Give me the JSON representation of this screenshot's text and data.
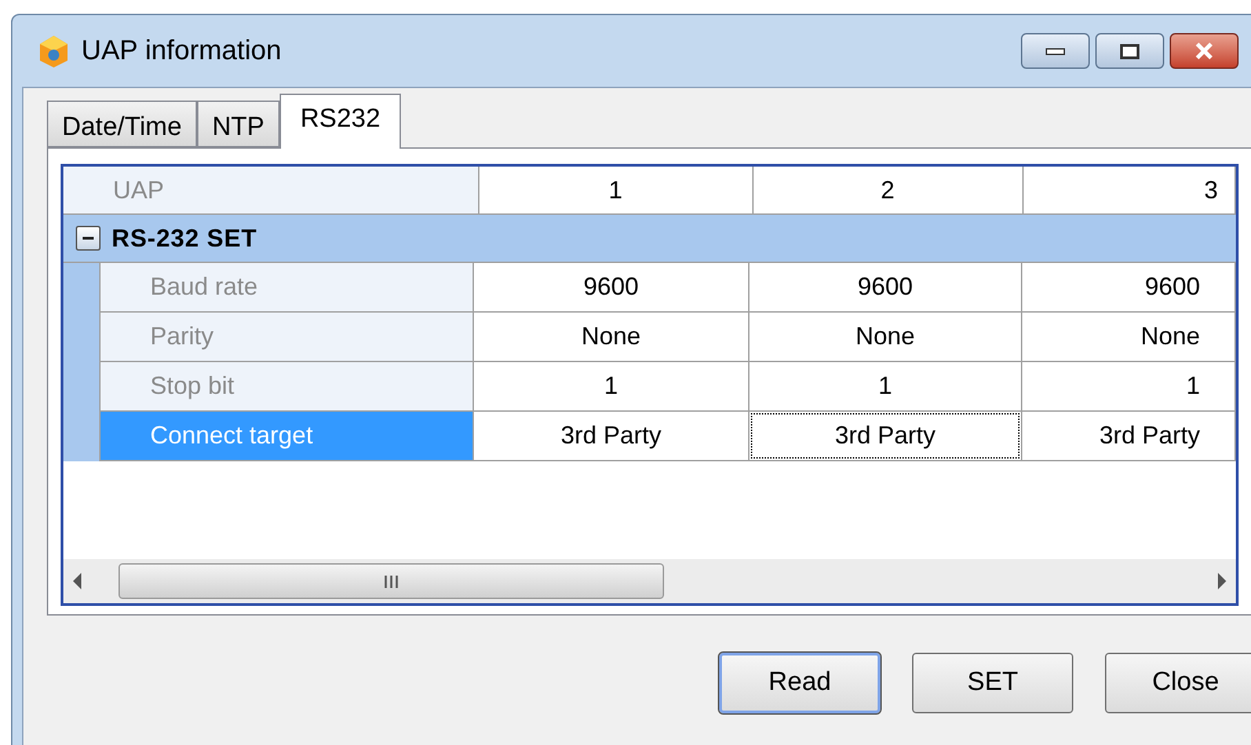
{
  "window": {
    "title": "UAP information"
  },
  "tabs": [
    {
      "label": "Date/Time",
      "selected": false
    },
    {
      "label": "NTP",
      "selected": false
    },
    {
      "label": "RS232",
      "selected": true
    }
  ],
  "grid": {
    "header": {
      "label": "UAP",
      "values": [
        "1",
        "2",
        "3"
      ]
    },
    "group": {
      "label": "RS-232 SET",
      "expanded": true
    },
    "rows": [
      {
        "label": "Baud rate",
        "values": [
          "9600",
          "9600",
          "9600"
        ],
        "selected": false,
        "focused": [
          false,
          false,
          false
        ]
      },
      {
        "label": "Parity",
        "values": [
          "None",
          "None",
          "None"
        ],
        "selected": false,
        "focused": [
          false,
          false,
          false
        ]
      },
      {
        "label": "Stop bit",
        "values": [
          "1",
          "1",
          "1"
        ],
        "selected": false,
        "focused": [
          false,
          false,
          false
        ]
      },
      {
        "label": "Connect target",
        "values": [
          "3rd Party",
          "3rd Party",
          "3rd Party"
        ],
        "selected": true,
        "focused": [
          false,
          true,
          false
        ]
      }
    ]
  },
  "buttons": [
    {
      "label": "Read",
      "default": true
    },
    {
      "label": "SET",
      "default": false
    },
    {
      "label": "Close",
      "default": false
    }
  ]
}
